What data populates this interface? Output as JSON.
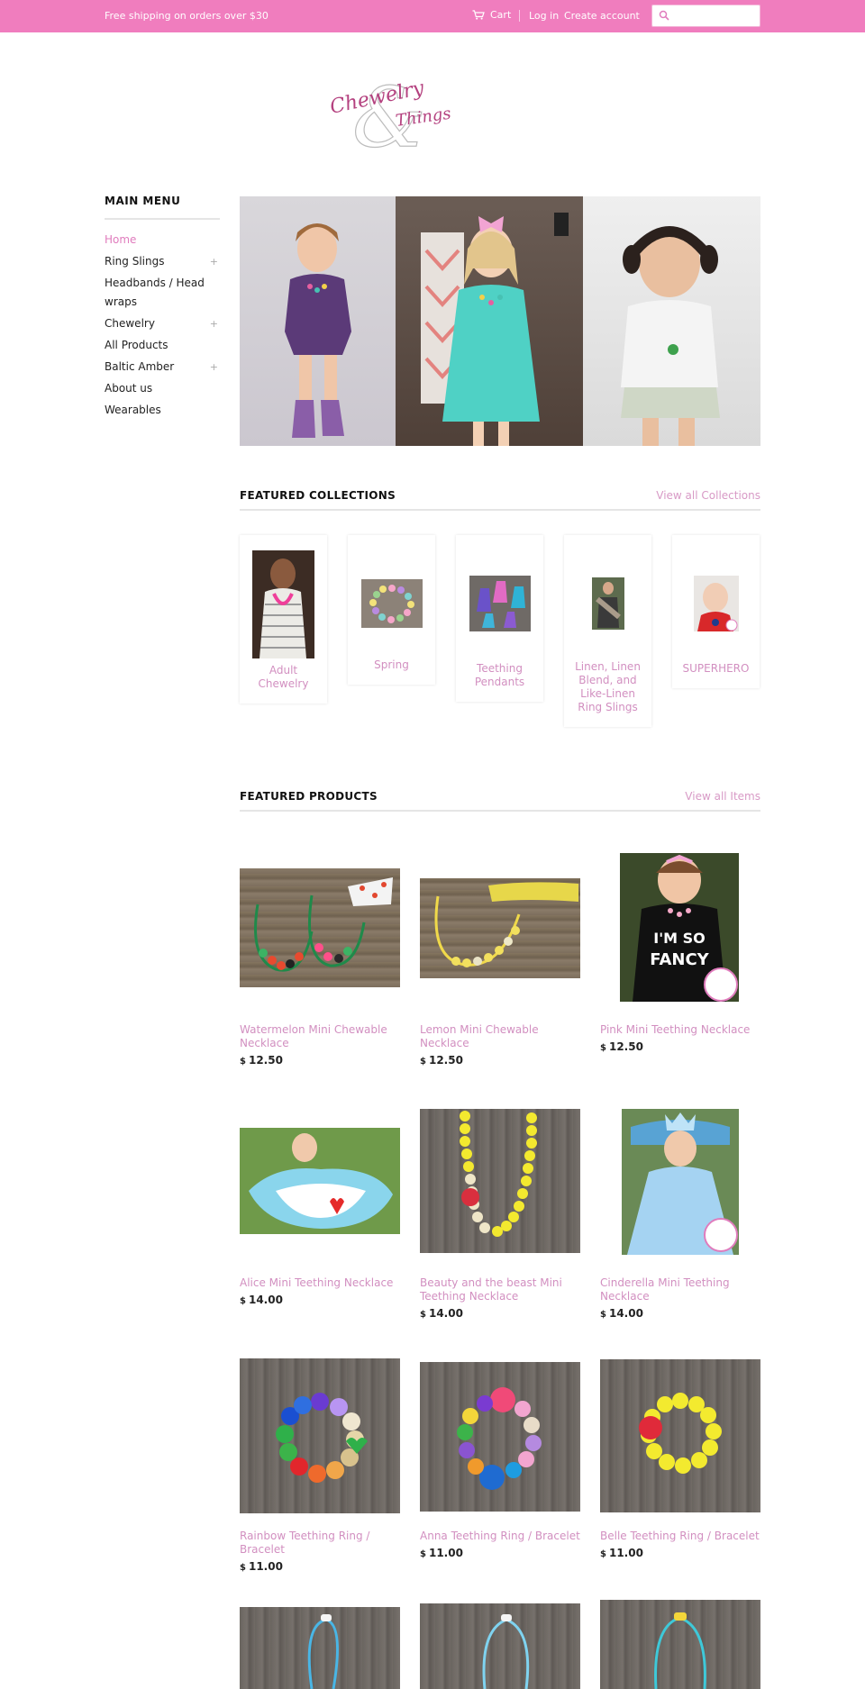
{
  "topbar": {
    "promo": "Free shipping on orders over $30",
    "cart": "Cart",
    "login": "Log in",
    "create_account": "Create account",
    "search_placeholder": ""
  },
  "logo": {
    "line1": "Chewelry",
    "line2": "Things"
  },
  "sidebar": {
    "heading": "MAIN MENU",
    "items": [
      {
        "label": "Home",
        "expandable": false,
        "active": true
      },
      {
        "label": "Ring Slings",
        "expandable": true
      },
      {
        "label": "Headbands / Head wraps",
        "expandable": false
      },
      {
        "label": "Chewelry",
        "expandable": true
      },
      {
        "label": "All Products",
        "expandable": false
      },
      {
        "label": "Baltic Amber",
        "expandable": true
      },
      {
        "label": "About us",
        "expandable": false
      },
      {
        "label": "Wearables",
        "expandable": false
      }
    ],
    "plus_symbol": "+"
  },
  "collections": {
    "heading": "FEATURED COLLECTIONS",
    "view_all": "View all Collections",
    "items": [
      {
        "name": "Adult Chewelry"
      },
      {
        "name": "Spring"
      },
      {
        "name": "Teething Pendants"
      },
      {
        "name": "Linen, Linen Blend, and Like-Linen Ring Slings"
      },
      {
        "name": "SUPERHERO"
      }
    ]
  },
  "products": {
    "heading": "FEATURED PRODUCTS",
    "view_all": "View all Items",
    "currency": "$",
    "items": [
      {
        "name": "Watermelon Mini Chewable Necklace",
        "price": "12.50"
      },
      {
        "name": "Lemon Mini Chewable Necklace",
        "price": "12.50"
      },
      {
        "name": "Pink Mini Teething Necklace",
        "price": "12.50"
      },
      {
        "name": "Alice Mini Teething Necklace",
        "price": "14.00"
      },
      {
        "name": "Beauty and the beast Mini Teething Necklace",
        "price": "14.00"
      },
      {
        "name": "Cinderella Mini Teething Necklace",
        "price": "14.00"
      },
      {
        "name": "Rainbow Teething Ring / Bracelet",
        "price": "11.00"
      },
      {
        "name": "Anna Teething Ring / Bracelet",
        "price": "11.00"
      },
      {
        "name": "Belle Teething Ring / Bracelet",
        "price": "11.00"
      }
    ]
  },
  "colors": {
    "topbar": "#f07dbe",
    "accent_link": "#d28fc0",
    "active_menu": "#e07cbd"
  }
}
